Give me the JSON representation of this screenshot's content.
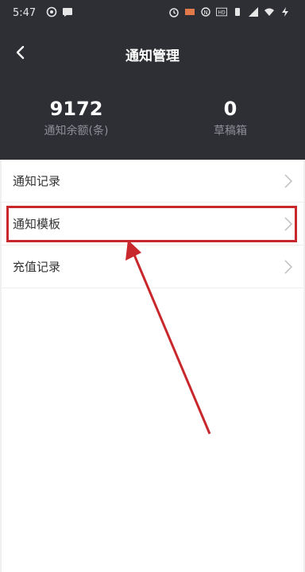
{
  "status_bar": {
    "time": "5:47",
    "icons_left": [
      "alarm-icon",
      "chat-icon"
    ],
    "icons_right": [
      "alarm-clock-icon",
      "battery-saver-icon",
      "nfc-icon",
      "hd-icon",
      "vibrate-icon",
      "signal-icon",
      "wifi-icon",
      "charging-icon"
    ]
  },
  "header": {
    "title": "通知管理",
    "stats": [
      {
        "value": "9172",
        "label": "通知余额(条)"
      },
      {
        "value": "0",
        "label": "草稿箱"
      }
    ]
  },
  "list": {
    "items": [
      {
        "label": "通知记录"
      },
      {
        "label": "通知模板"
      },
      {
        "label": "充值记录"
      }
    ]
  },
  "annotation": {
    "color": "#c8282c",
    "highlighted_item": "通知模板"
  }
}
